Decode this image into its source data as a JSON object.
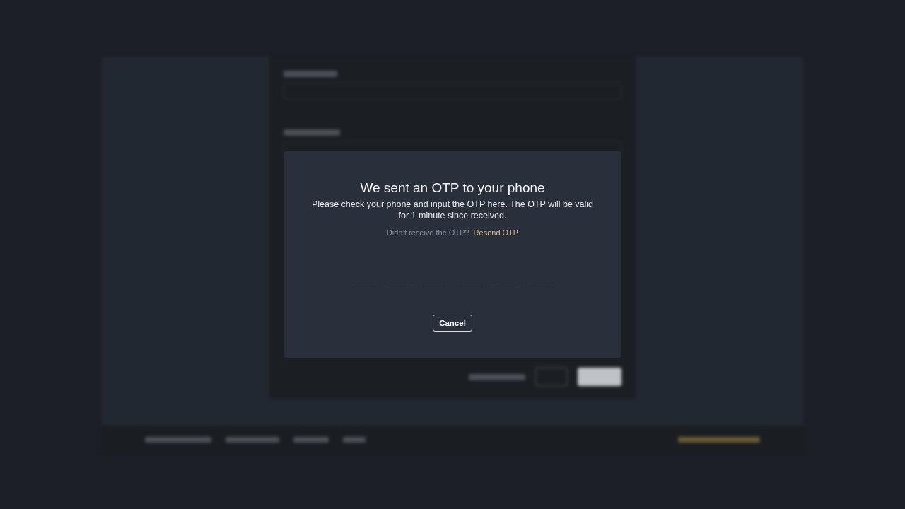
{
  "modal": {
    "title": "We sent an OTP to your phone",
    "message": "Please check your phone and input the OTP here. The OTP will be valid for 1 minute since received.",
    "resend_prompt": "Didn’t receive the OTP?",
    "resend_link": "Resend OTP",
    "otp_fields": [
      {
        "focused": false
      },
      {
        "focused": false
      },
      {
        "focused": false
      },
      {
        "focused": false
      },
      {
        "focused": false
      },
      {
        "focused": false
      }
    ],
    "cancel_button": "Cancel"
  }
}
